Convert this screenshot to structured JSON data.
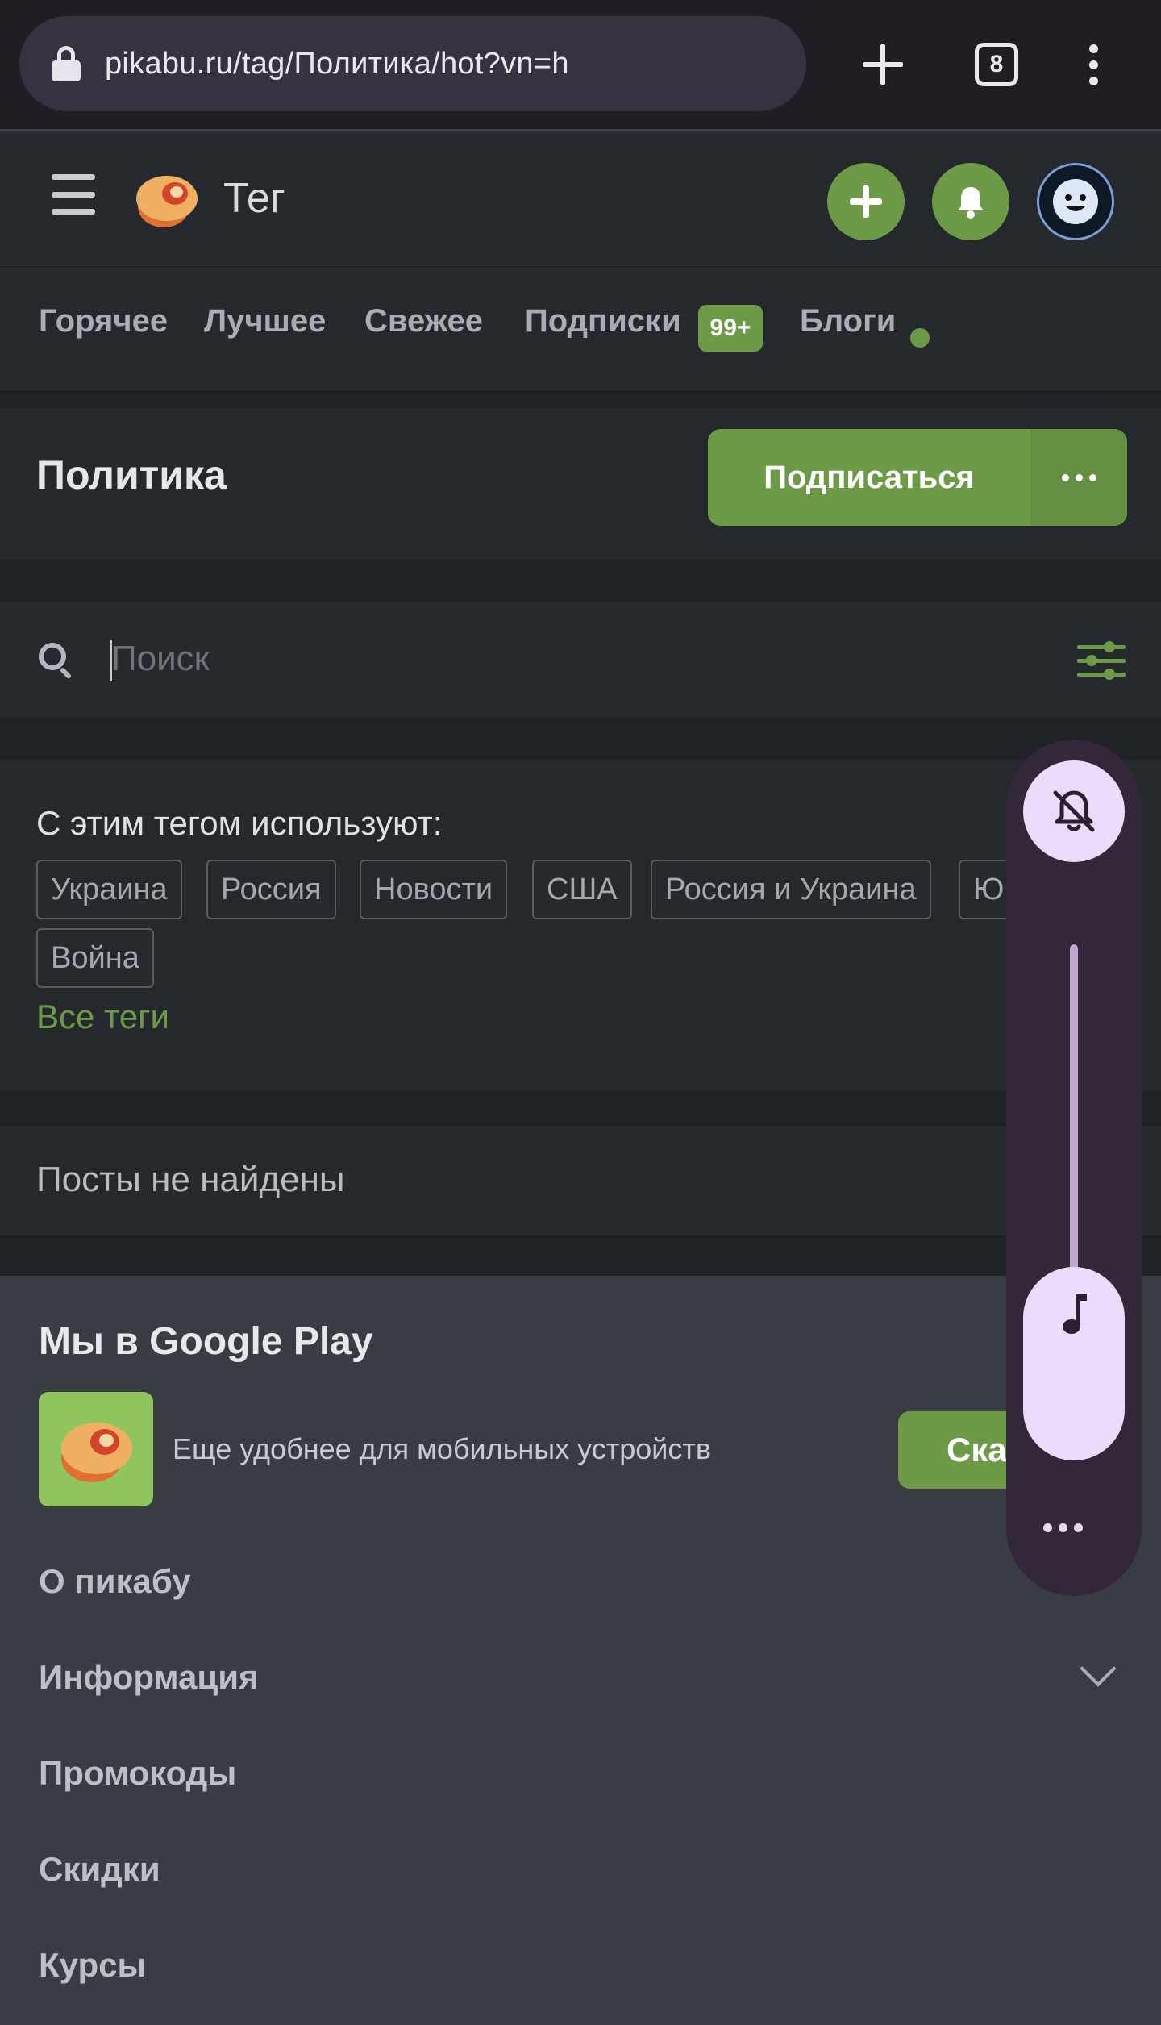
{
  "browser": {
    "url": "pikabu.ru/tag/Политика/hot?vn=h",
    "tab_count": "8"
  },
  "header": {
    "title": "Тег"
  },
  "nav": {
    "tabs": [
      {
        "label": "Горячее"
      },
      {
        "label": "Лучшее"
      },
      {
        "label": "Свежее"
      },
      {
        "label": "Подписки"
      },
      {
        "label": "Блоги"
      }
    ],
    "subs_badge": "99+"
  },
  "tag": {
    "title": "Политика",
    "subscribe_label": "Подписаться"
  },
  "search": {
    "placeholder": "Поиск"
  },
  "related": {
    "title": "С этим тегом используют:",
    "chips": [
      "Украина",
      "Россия",
      "Новости",
      "США",
      "Россия и Украина",
      "Юг",
      "Война"
    ],
    "all_tags": "Все теги"
  },
  "posts": {
    "empty_text": "Посты не найдены"
  },
  "footer": {
    "google_play_title": "Мы в Google Play",
    "google_play_text": "Еще удобнее для мобильных устройств",
    "download_label": "Ска",
    "links": [
      "О пикабу",
      "Информация",
      "Промокоды",
      "Скидки",
      "Курсы"
    ]
  },
  "volume": {
    "level": 0.15
  },
  "colors": {
    "accent": "#6c9a46",
    "background": "#25282d",
    "footer": "#393c42",
    "volume_panel": "#32283a"
  }
}
